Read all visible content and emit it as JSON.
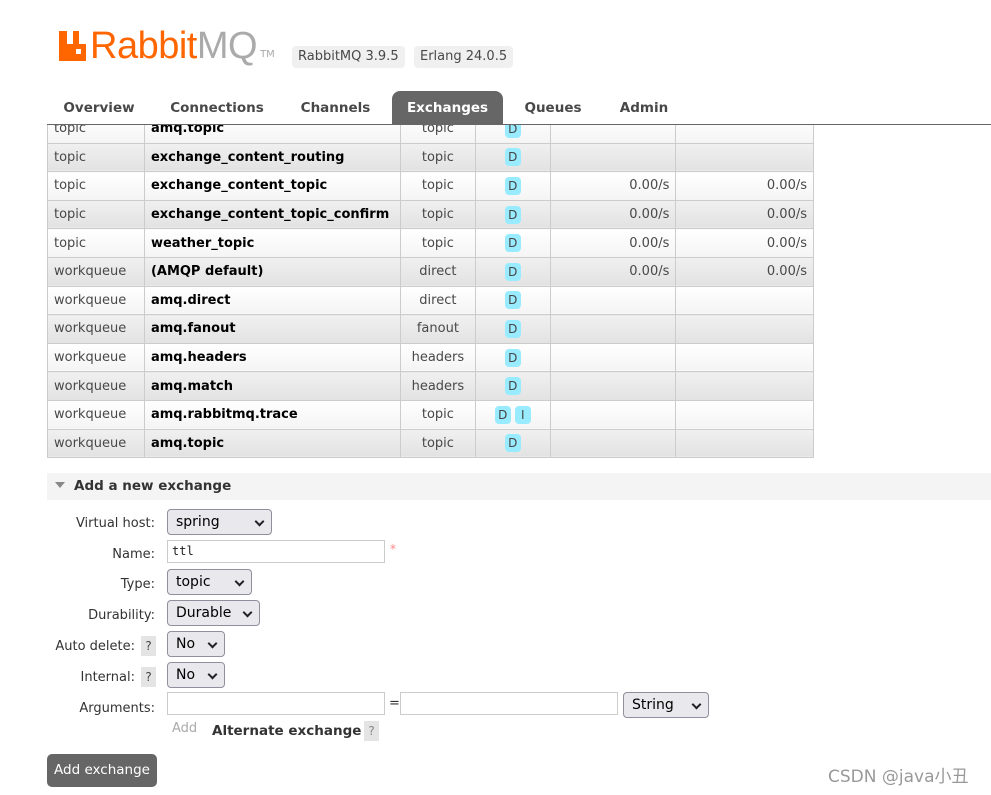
{
  "header": {
    "logo_text_orange": "Rabbit",
    "logo_text_grey": "MQ",
    "logo_tm": "TM",
    "rabbitmq_version": "RabbitMQ 3.9.5",
    "erlang_version": "Erlang 24.0.5"
  },
  "nav": {
    "tabs": [
      "Overview",
      "Connections",
      "Channels",
      "Exchanges",
      "Queues",
      "Admin"
    ],
    "active": "Exchanges"
  },
  "table": {
    "rows": [
      {
        "vhost": "topic",
        "name": "amq.topic",
        "type": "topic",
        "features": [
          "D"
        ],
        "rate_in": "",
        "rate_out": ""
      },
      {
        "vhost": "topic",
        "name": "exchange_content_routing",
        "type": "topic",
        "features": [
          "D"
        ],
        "rate_in": "",
        "rate_out": ""
      },
      {
        "vhost": "topic",
        "name": "exchange_content_topic",
        "type": "topic",
        "features": [
          "D"
        ],
        "rate_in": "0.00/s",
        "rate_out": "0.00/s"
      },
      {
        "vhost": "topic",
        "name": "exchange_content_topic_confirm",
        "type": "topic",
        "features": [
          "D"
        ],
        "rate_in": "0.00/s",
        "rate_out": "0.00/s"
      },
      {
        "vhost": "topic",
        "name": "weather_topic",
        "type": "topic",
        "features": [
          "D"
        ],
        "rate_in": "0.00/s",
        "rate_out": "0.00/s"
      },
      {
        "vhost": "workqueue",
        "name": "(AMQP default)",
        "type": "direct",
        "features": [
          "D"
        ],
        "rate_in": "0.00/s",
        "rate_out": "0.00/s"
      },
      {
        "vhost": "workqueue",
        "name": "amq.direct",
        "type": "direct",
        "features": [
          "D"
        ],
        "rate_in": "",
        "rate_out": ""
      },
      {
        "vhost": "workqueue",
        "name": "amq.fanout",
        "type": "fanout",
        "features": [
          "D"
        ],
        "rate_in": "",
        "rate_out": ""
      },
      {
        "vhost": "workqueue",
        "name": "amq.headers",
        "type": "headers",
        "features": [
          "D"
        ],
        "rate_in": "",
        "rate_out": ""
      },
      {
        "vhost": "workqueue",
        "name": "amq.match",
        "type": "headers",
        "features": [
          "D"
        ],
        "rate_in": "",
        "rate_out": ""
      },
      {
        "vhost": "workqueue",
        "name": "amq.rabbitmq.trace",
        "type": "topic",
        "features": [
          "D",
          "I"
        ],
        "rate_in": "",
        "rate_out": ""
      },
      {
        "vhost": "workqueue",
        "name": "amq.topic",
        "type": "topic",
        "features": [
          "D"
        ],
        "rate_in": "",
        "rate_out": ""
      }
    ]
  },
  "form": {
    "section_title": "Add a new exchange",
    "virtual_host": {
      "label": "Virtual host:",
      "value": "spring"
    },
    "name": {
      "label": "Name:",
      "value": "ttl",
      "required_mark": "*"
    },
    "type": {
      "label": "Type:",
      "value": "topic"
    },
    "durability": {
      "label": "Durability:",
      "value": "Durable"
    },
    "auto_delete": {
      "label": "Auto delete:",
      "value": "No",
      "help": "?"
    },
    "internal": {
      "label": "Internal:",
      "value": "No",
      "help": "?"
    },
    "arguments": {
      "label": "Arguments:",
      "key": "",
      "equals": "=",
      "value": "",
      "type": "String"
    },
    "add_link": "Add",
    "alternate_exchange": "Alternate exchange",
    "alternate_help": "?",
    "submit": "Add exchange"
  },
  "colors": {
    "brand": "#ff6600",
    "badge": "#99ebff",
    "active_tab": "#666666"
  },
  "watermark": "CSDN @java小丑"
}
